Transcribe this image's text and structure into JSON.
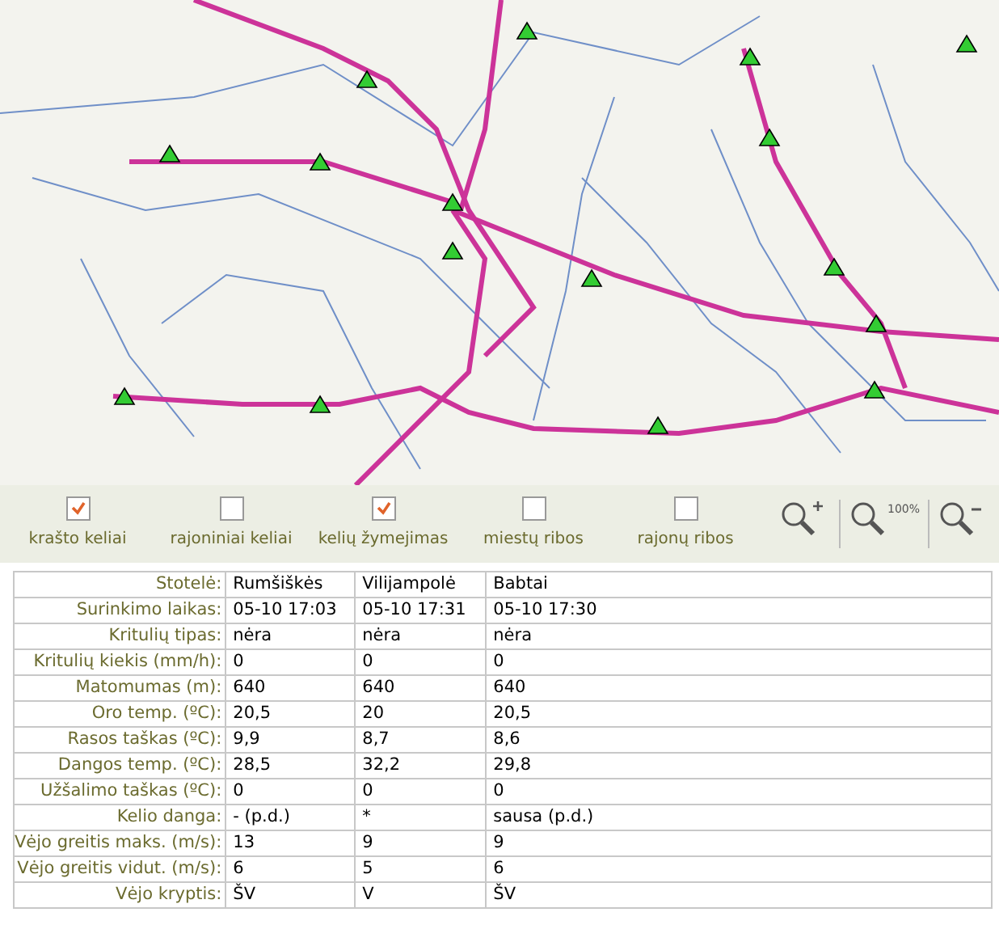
{
  "layers": [
    {
      "label": "krašto keliai",
      "checked": true
    },
    {
      "label": "rajoniniai keliai",
      "checked": false
    },
    {
      "label": "kelių žymejimas",
      "checked": true
    },
    {
      "label": "miestų ribos",
      "checked": false
    },
    {
      "label": "rajonų ribos",
      "checked": false
    }
  ],
  "zoom_buttons": [
    {
      "kind": "in"
    },
    {
      "kind": "reset",
      "label": "100%"
    },
    {
      "kind": "out"
    }
  ],
  "table": {
    "rows": [
      {
        "label": "Stotelė:",
        "values": [
          "Rumšiškės",
          "Vilijampolė",
          "Babtai"
        ]
      },
      {
        "label": "Surinkimo laikas:",
        "values": [
          "05-10 17:03",
          "05-10 17:31",
          "05-10 17:30"
        ]
      },
      {
        "label": "Kritulių tipas:",
        "values": [
          "nėra",
          "nėra",
          "nėra"
        ]
      },
      {
        "label": "Kritulių kiekis (mm/h):",
        "values": [
          "0",
          "0",
          "0"
        ]
      },
      {
        "label": "Matomumas (m):",
        "values": [
          "640",
          "640",
          "640"
        ]
      },
      {
        "label": "Oro temp. (ºC):",
        "values": [
          "20,5",
          "20",
          "20,5"
        ]
      },
      {
        "label": "Rasos taškas (ºC):",
        "values": [
          "9,9",
          "8,7",
          "8,6"
        ]
      },
      {
        "label": "Dangos temp. (ºC):",
        "values": [
          "28,5",
          "32,2",
          "29,8"
        ]
      },
      {
        "label": "Užšalimo taškas (ºC):",
        "values": [
          "0",
          "0",
          "0"
        ]
      },
      {
        "label": "Kelio danga:",
        "values": [
          "- (p.d.)",
          "*",
          "sausa (p.d.)"
        ]
      },
      {
        "label": "Vėjo greitis maks. (m/s):",
        "values": [
          "13",
          "9",
          "9"
        ]
      },
      {
        "label": "Vėjo greitis vidut. (m/s):",
        "values": [
          "6",
          "5",
          "6"
        ]
      },
      {
        "label": "Vėjo kryptis:",
        "values": [
          "ŠV",
          "V",
          "ŠV"
        ]
      }
    ]
  }
}
